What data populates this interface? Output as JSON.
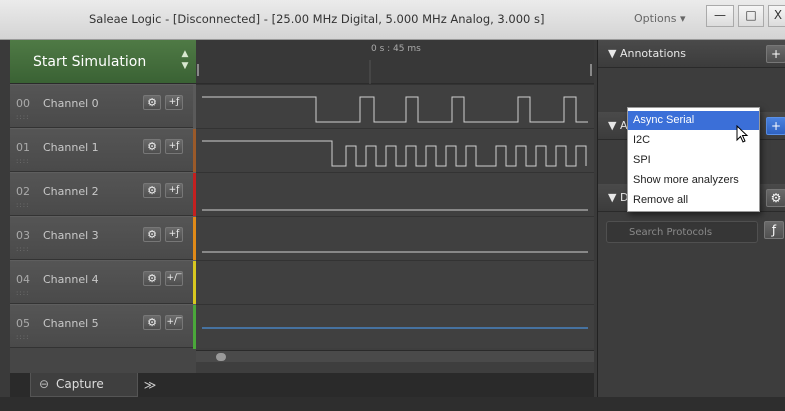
{
  "window": {
    "title": "Saleae Logic - [Disconnected] - [25.00 MHz Digital, 5.000 MHz Analog, 3.000 s]",
    "options_label": "Options ▾",
    "min_label": "—",
    "max_label": "□",
    "close_label": "X"
  },
  "simulation": {
    "label": "Start Simulation",
    "stepper_up": "▲",
    "stepper_down": "▼"
  },
  "channels": [
    {
      "num": "00",
      "name": "Channel 0",
      "trigger": "+ƒ",
      "color": "#5a5a5a"
    },
    {
      "num": "01",
      "name": "Channel 1",
      "trigger": "+ƒ",
      "color": "#9a5a2a"
    },
    {
      "num": "02",
      "name": "Channel 2",
      "trigger": "+ƒ",
      "color": "#c42020"
    },
    {
      "num": "03",
      "name": "Channel 3",
      "trigger": "+ƒ",
      "color": "#e08a18"
    },
    {
      "num": "04",
      "name": "Channel 4",
      "trigger": "+/‾",
      "color": "#d8c820"
    },
    {
      "num": "05",
      "name": "Channel 5",
      "trigger": "+/‾",
      "color": "#4aa83a"
    }
  ],
  "channel_dots": "::::",
  "gear_glyph": "⚙",
  "time_label": "0 s : 45 ms",
  "bottom_tabs": {
    "capture": "Capture",
    "more": "≫"
  },
  "right_panel": {
    "annotations": "▼ Annotations",
    "analyzers": "▼ A",
    "decoded": "▼ D",
    "plus": "+",
    "search_placeholder": "Search Protocols",
    "trigger_glyph": "ƒ"
  },
  "dropdown": {
    "items": [
      "Async Serial",
      "I2C",
      "SPI",
      "Show more analyzers",
      "Remove all"
    ],
    "selected": "Async Serial"
  },
  "colors": {
    "accent_green": "#3f6a38",
    "selection_blue": "#3b6fd8",
    "analog_line": "#4a90d9"
  }
}
